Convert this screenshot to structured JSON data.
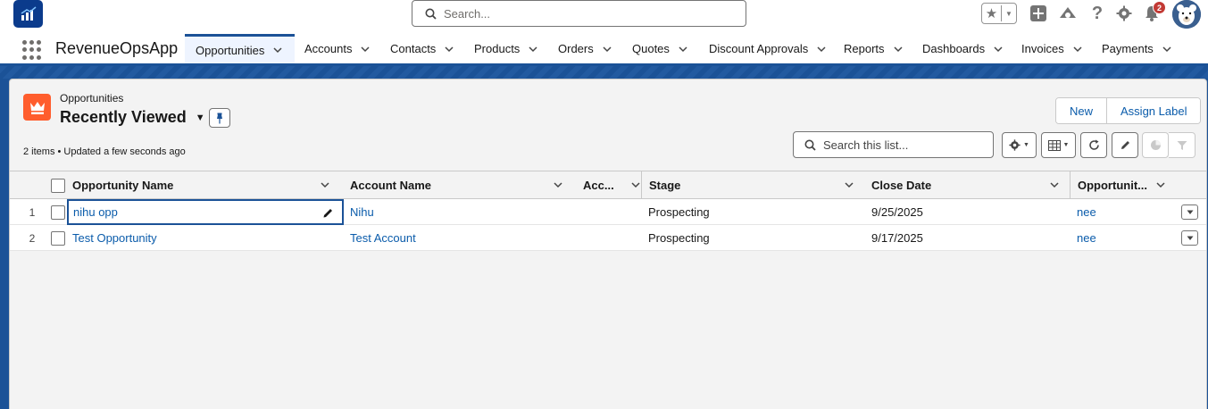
{
  "header": {
    "search_placeholder": "Search...",
    "notification_count": "2"
  },
  "nav": {
    "app_name": "RevenueOpsApp",
    "items": [
      {
        "label": "Opportunities",
        "active": true
      },
      {
        "label": "Accounts"
      },
      {
        "label": "Contacts"
      },
      {
        "label": "Products"
      },
      {
        "label": "Orders"
      },
      {
        "label": "Quotes"
      },
      {
        "label": "Discount Approvals"
      },
      {
        "label": "Reports"
      },
      {
        "label": "Dashboards"
      },
      {
        "label": "Invoices"
      },
      {
        "label": "Payments"
      }
    ]
  },
  "list_view": {
    "object_label": "Opportunities",
    "view_name": "Recently Viewed",
    "meta": "2 items • Updated a few seconds ago",
    "buttons": {
      "new": "New",
      "assign_label": "Assign Label"
    },
    "search_placeholder": "Search this list..."
  },
  "table": {
    "columns": [
      "Opportunity Name",
      "Account Name",
      "Acc...",
      "Stage",
      "Close Date",
      "Opportunit..."
    ],
    "rows": [
      {
        "num": "1",
        "opportunity_name": "nihu opp",
        "account_name": "Nihu",
        "acc": "",
        "stage": "Prospecting",
        "close_date": "9/25/2025",
        "owner": "nee"
      },
      {
        "num": "2",
        "opportunity_name": "Test Opportunity",
        "account_name": "Test Account",
        "acc": "",
        "stage": "Prospecting",
        "close_date": "9/17/2025",
        "owner": "nee"
      }
    ]
  },
  "colors": {
    "brand_blue": "#1b5297",
    "link": "#0b5cab",
    "opportunity_icon": "#ff5d2d",
    "badge": "#c23934"
  }
}
